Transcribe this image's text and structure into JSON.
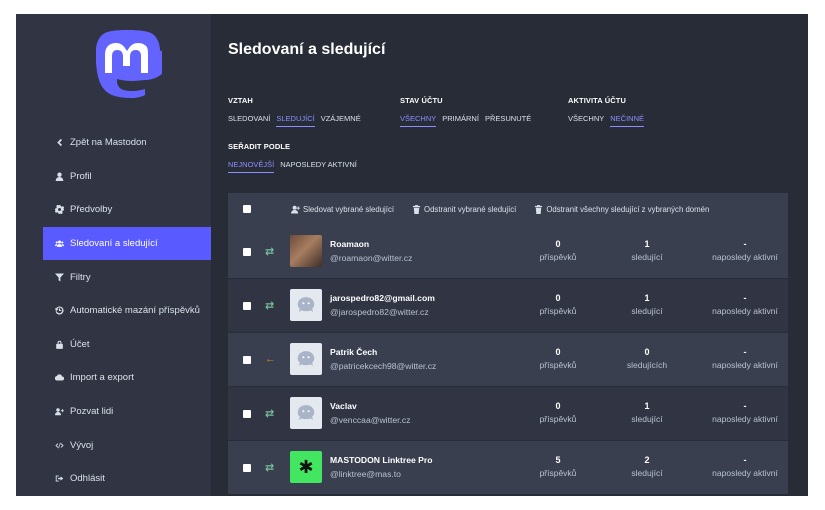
{
  "sidebar": {
    "logo": "mastodon-logo",
    "items": [
      {
        "label": "Zpět na Mastodon",
        "icon": "chevron-left-icon",
        "active": false
      },
      {
        "label": "Profil",
        "icon": "user-icon",
        "active": false
      },
      {
        "label": "Předvolby",
        "icon": "gear-icon",
        "active": false
      },
      {
        "label": "Sledovaní a sledující",
        "icon": "users-icon",
        "active": true
      },
      {
        "label": "Filtry",
        "icon": "filter-icon",
        "active": false
      },
      {
        "label": "Automatické mazání příspěvků",
        "icon": "history-icon",
        "active": false
      },
      {
        "label": "Účet",
        "icon": "lock-icon",
        "active": false
      },
      {
        "label": "Import a export",
        "icon": "cloud-icon",
        "active": false
      },
      {
        "label": "Pozvat lidi",
        "icon": "user-plus-icon",
        "active": false
      },
      {
        "label": "Vývoj",
        "icon": "code-icon",
        "active": false
      },
      {
        "label": "Odhlásit",
        "icon": "sign-out-icon",
        "active": false
      }
    ]
  },
  "main": {
    "title": "Sledovaní a sledující",
    "filters": {
      "relationship": {
        "label": "VZTAH",
        "options": [
          "SLEDOVANÍ",
          "SLEDUJÍCÍ",
          "VZÁJEMNÉ"
        ],
        "selected": 1
      },
      "status": {
        "label": "STAV ÚČTU",
        "options": [
          "VŠECHNY",
          "PRIMÁRNÍ",
          "PŘESUNUTÉ"
        ],
        "selected": 0
      },
      "activity": {
        "label": "AKTIVITA ÚČTU",
        "options": [
          "VŠECHNY",
          "NEČINNÉ"
        ],
        "selected": 1
      },
      "sort": {
        "label": "SEŘADIT PODLE",
        "options": [
          "NEJNOVĚJŠÍ",
          "NAPOSLEDY AKTIVNÍ"
        ],
        "selected": 0
      }
    },
    "actions": {
      "follow_selected": "Sledovat vybrané sledující",
      "remove_selected": "Odstranit vybrané sledující",
      "remove_domains": "Odstranit všechny sledující z vybraných domén"
    },
    "accounts": [
      {
        "name": "Roamaon",
        "acct": "@roamaon@witter.cz",
        "relation": "mutual",
        "avatar": "photo",
        "posts": "0",
        "posts_label": "příspěvků",
        "followers": "1",
        "followers_label": "sledující",
        "last_active": "-",
        "last_active_label": "naposledy aktivní"
      },
      {
        "name": "jarospedro82@gmail.com",
        "acct": "@jarospedro82@witter.cz",
        "relation": "mutual",
        "avatar": "default",
        "posts": "0",
        "posts_label": "příspěvků",
        "followers": "1",
        "followers_label": "sledující",
        "last_active": "-",
        "last_active_label": "naposledy aktivní"
      },
      {
        "name": "Patrik Čech",
        "acct": "@patricekcech98@witter.cz",
        "relation": "follower",
        "avatar": "default",
        "posts": "0",
        "posts_label": "příspěvků",
        "followers": "0",
        "followers_label": "sledujících",
        "last_active": "-",
        "last_active_label": "naposledy aktivní"
      },
      {
        "name": "Vaclav",
        "acct": "@venccaa@witter.cz",
        "relation": "mutual",
        "avatar": "default",
        "posts": "0",
        "posts_label": "příspěvků",
        "followers": "1",
        "followers_label": "sledující",
        "last_active": "-",
        "last_active_label": "naposledy aktivní"
      },
      {
        "name": "MASTODON Linktree Pro",
        "acct": "@linktree@mas.to",
        "relation": "mutual",
        "avatar": "linktree",
        "posts": "5",
        "posts_label": "příspěvků",
        "followers": "2",
        "followers_label": "sledující",
        "last_active": "-",
        "last_active_label": "naposledy aktivní"
      }
    ]
  },
  "colors": {
    "bg": "#282c37",
    "sidebar": "#313543",
    "accent": "#595aff",
    "link": "#8c8dff",
    "mutual": "#79bd9a",
    "follower": "#ca8f04"
  }
}
